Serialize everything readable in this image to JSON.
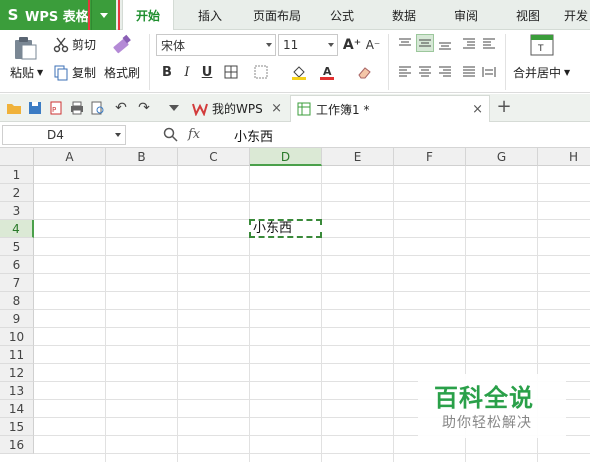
{
  "app": {
    "title": "WPS 表格",
    "logo": "S"
  },
  "menu": {
    "tabs": [
      {
        "label": "开始",
        "active": true
      },
      {
        "label": "插入"
      },
      {
        "label": "页面布局"
      },
      {
        "label": "公式"
      },
      {
        "label": "数据"
      },
      {
        "label": "审阅"
      },
      {
        "label": "视图"
      },
      {
        "label": "开发"
      }
    ]
  },
  "ribbon": {
    "paste": "粘贴",
    "cut": "剪切",
    "copy": "复制",
    "format_painter": "格式刷",
    "font_name": "宋体",
    "font_size": "11",
    "bold": "B",
    "italic": "I",
    "underline": "U",
    "merge_center": "合并居中",
    "font_color": "#e23030",
    "fill_color": "#f5d11a"
  },
  "docs": {
    "tabs": [
      {
        "label": "我的WPS"
      },
      {
        "label": "工作簿1 *",
        "active": true
      }
    ],
    "add": "+"
  },
  "formula_bar": {
    "cell_ref": "D4",
    "fx": "fx",
    "value": "小东西"
  },
  "sheet": {
    "columns": [
      "A",
      "B",
      "C",
      "D",
      "E",
      "F",
      "G",
      "H"
    ],
    "rows": [
      "1",
      "2",
      "3",
      "4",
      "5",
      "6",
      "7",
      "8",
      "9",
      "10",
      "11",
      "12",
      "13",
      "14",
      "15",
      "16"
    ],
    "active_col": "D",
    "active_row": "4",
    "active_value": "小东西"
  },
  "watermark": {
    "title": "百科全说",
    "subtitle": "助你轻松解决"
  },
  "colors": {
    "accent": "#3b9d3b",
    "highlight": "#e8383d"
  }
}
